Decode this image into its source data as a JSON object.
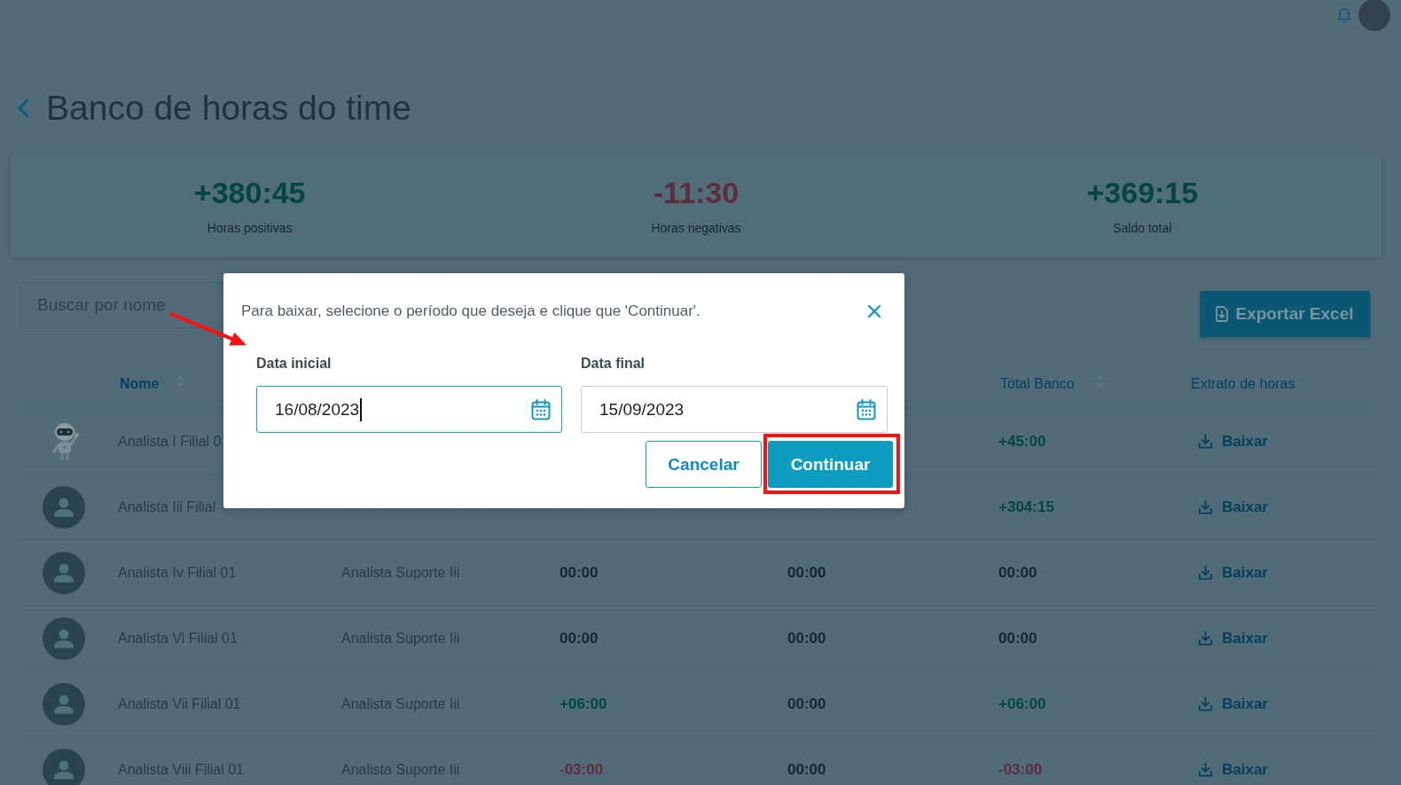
{
  "page": {
    "title": "Banco de horas do time"
  },
  "summary": [
    {
      "value": "+380:45",
      "label": "Horas positivas",
      "kind": "positive"
    },
    {
      "value": "-11:30",
      "label": "Horas negativas",
      "kind": "negative"
    },
    {
      "value": "+369:15",
      "label": "Saldo total",
      "kind": "positive"
    }
  ],
  "search": {
    "placeholder": "Buscar por nome"
  },
  "export_button": {
    "label": "Exportar Excel"
  },
  "table": {
    "headers": {
      "name": {
        "label": "Nome",
        "sortable": true
      },
      "total": {
        "label": "Total Banco",
        "sortable": true
      },
      "action": {
        "label": "Extrato de horas"
      }
    },
    "rows": [
      {
        "avatar": {
          "kind": "robot"
        },
        "name": "Analista I Filial 0",
        "total": {
          "text": "+45:00",
          "kind": "positive"
        },
        "action": "Baixar"
      },
      {
        "avatar": {
          "kind": "person"
        },
        "name": "Analista Iii Filial",
        "total": {
          "text": "+304:15",
          "kind": "positive"
        },
        "action": "Baixar"
      },
      {
        "avatar": {
          "kind": "person"
        },
        "name": "Analista Iv Filial 01",
        "column_2": "Analista Suporte Iii",
        "column_3": {
          "text": "00:00",
          "kind": "neutral"
        },
        "column_4": {
          "text": "00:00",
          "kind": "neutral"
        },
        "total": {
          "text": "00:00",
          "kind": "neutral"
        },
        "action": "Baixar"
      },
      {
        "avatar": {
          "kind": "person"
        },
        "name": "Analista Vi Filial 01",
        "column_2": "Analista Suporte Iii",
        "column_3": {
          "text": "00:00",
          "kind": "neutral"
        },
        "column_4": {
          "text": "00:00",
          "kind": "neutral"
        },
        "total": {
          "text": "00:00",
          "kind": "neutral"
        },
        "action": "Baixar"
      },
      {
        "avatar": {
          "kind": "person"
        },
        "name": "Analista Vii Filial 01",
        "column_2": "Analista Suporte Iii",
        "column_3": {
          "text": "+06:00",
          "kind": "positive"
        },
        "column_4": {
          "text": "00:00",
          "kind": "neutral"
        },
        "total": {
          "text": "+06:00",
          "kind": "positive"
        },
        "action": "Baixar"
      },
      {
        "avatar": {
          "kind": "person"
        },
        "name": "Analista Viii Filial 01",
        "column_2": "Analista Suporte Iii",
        "column_3": {
          "text": "-03:00",
          "kind": "negative"
        },
        "column_4": {
          "text": "00:00",
          "kind": "neutral"
        },
        "total": {
          "text": "-03:00",
          "kind": "negative"
        },
        "action": "Baixar"
      }
    ]
  },
  "dialog": {
    "message": "Para baixar, selecione o período que deseja e clique que 'Continuar'.",
    "fields": [
      {
        "label": "Data inicial",
        "value": "16/08/2023",
        "focused": true
      },
      {
        "label": "Data final",
        "value": "15/09/2023",
        "focused": false
      }
    ],
    "buttons": [
      {
        "label": "Cancelar",
        "kind": "secondary",
        "highlighted": false
      },
      {
        "label": "Continuar",
        "kind": "primary",
        "highlighted": true
      }
    ]
  }
}
